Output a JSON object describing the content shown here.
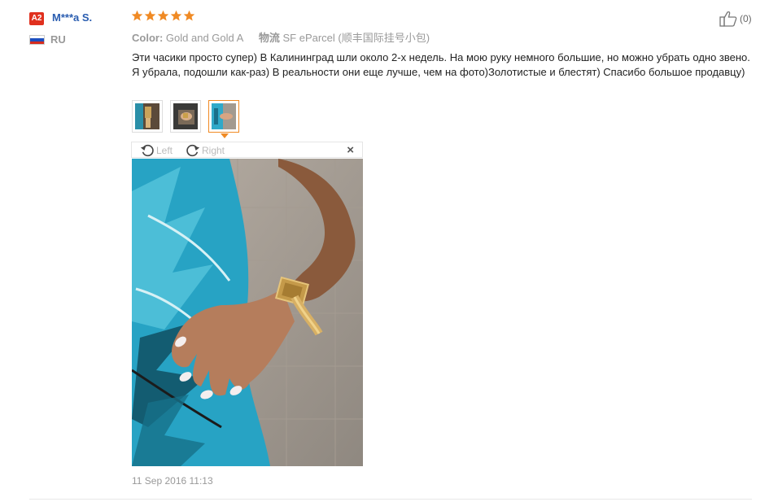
{
  "user": {
    "badge": "A2",
    "name": "M***a S.",
    "country": "RU",
    "flag_colors": [
      "#ffffff",
      "#1c4fc0",
      "#d52b1e"
    ]
  },
  "review": {
    "rating": 5,
    "star_color": "#f08a24",
    "color_label": "Color:",
    "color_value": "Gold and Gold A",
    "shipping_label": "物流",
    "shipping_value": "SF eParcel (顺丰国际挂号小包)",
    "text": "Эти часики просто супер) В Калининград шли около 2-х недель. На мою руку немного большие, но можно убрать одно звено. Я убрала, подошли как-раз) В реальности они еще лучше, чем на фото)Золотистые и блестят) Спасибо большое продавцу)",
    "date": "11 Sep 2016 11:13"
  },
  "viewer": {
    "rotate_left": "Left",
    "rotate_right": "Right",
    "close": "×"
  },
  "helpful": {
    "count": "(0)"
  }
}
